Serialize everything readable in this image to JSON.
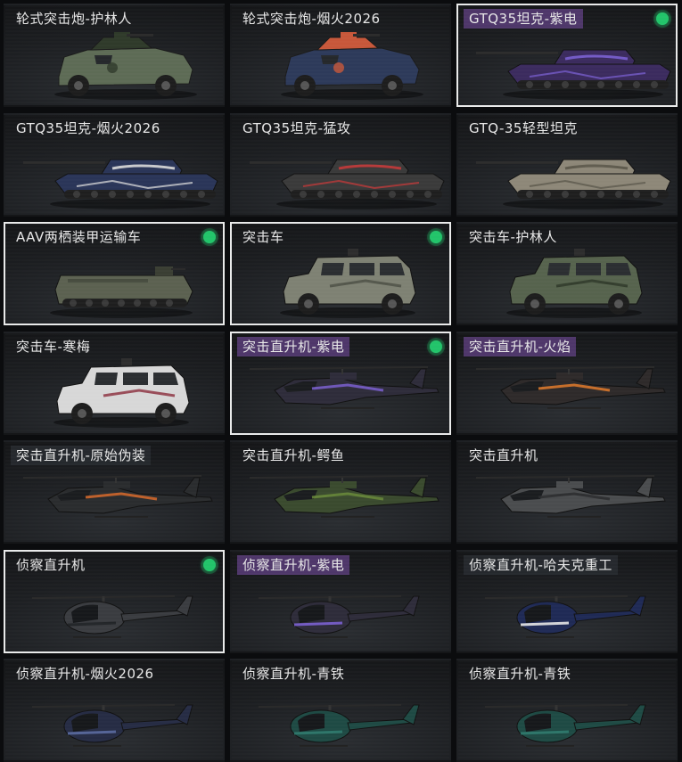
{
  "items": [
    {
      "label": "轮式突击炮-护林人",
      "type": "wheeled",
      "color": "#5d6b55",
      "accent": "#2f3a2a",
      "selected": false,
      "badge": false,
      "tint": ""
    },
    {
      "label": "轮式突击炮-烟火2026",
      "type": "wheeled",
      "color": "#2d3a5a",
      "accent": "#c7573a",
      "selected": false,
      "badge": false,
      "tint": ""
    },
    {
      "label": "GTQ35坦克-紫电",
      "type": "tank",
      "color": "#3b2b5e",
      "accent": "#7a5fd0",
      "selected": true,
      "badge": true,
      "tint": "purple"
    },
    {
      "label": "GTQ35坦克-烟火2026",
      "type": "tank",
      "color": "#2a3558",
      "accent": "#d9d9d9",
      "selected": false,
      "badge": false,
      "tint": ""
    },
    {
      "label": "GTQ35坦克-猛攻",
      "type": "tank",
      "color": "#3a3a3a",
      "accent": "#c43a3a",
      "selected": false,
      "badge": false,
      "tint": ""
    },
    {
      "label": "GTQ-35轻型坦克",
      "type": "tank",
      "color": "#8d8778",
      "accent": "#5a5649",
      "selected": false,
      "badge": false,
      "tint": ""
    },
    {
      "label": "AAV两栖装甲运输车",
      "type": "apc",
      "color": "#5b6150",
      "accent": "#3a3e33",
      "selected": true,
      "badge": true,
      "tint": ""
    },
    {
      "label": "突击车",
      "type": "suv",
      "color": "#7e8173",
      "accent": "#4a4c42",
      "selected": true,
      "badge": true,
      "tint": ""
    },
    {
      "label": "突击车-护林人",
      "type": "suv",
      "color": "#56634d",
      "accent": "#2c3527",
      "selected": false,
      "badge": false,
      "tint": ""
    },
    {
      "label": "突击车-寒梅",
      "type": "suv",
      "color": "#d7d7d7",
      "accent": "#8a2a3a",
      "selected": false,
      "badge": false,
      "tint": ""
    },
    {
      "label": "突击直升机-紫电",
      "type": "heli",
      "color": "#2e2c3a",
      "accent": "#7a5fd0",
      "selected": true,
      "badge": true,
      "tint": "purple"
    },
    {
      "label": "突击直升机-火焰",
      "type": "heli",
      "color": "#2e2a2a",
      "accent": "#e07a2a",
      "selected": false,
      "badge": false,
      "tint": "purple"
    },
    {
      "label": "突击直升机-原始伪装",
      "type": "heli",
      "color": "#2a2c2e",
      "accent": "#d86a2a",
      "selected": false,
      "badge": false,
      "tint": "dark"
    },
    {
      "label": "突击直升机-鳄鱼",
      "type": "heli",
      "color": "#3a4a2e",
      "accent": "#6a8a3a",
      "selected": false,
      "badge": false,
      "tint": ""
    },
    {
      "label": "突击直升机",
      "type": "heli",
      "color": "#4a4c4e",
      "accent": "#2a2c2e",
      "selected": false,
      "badge": false,
      "tint": ""
    },
    {
      "label": "侦察直升机",
      "type": "scout",
      "color": "#3a3c40",
      "accent": "#202226",
      "selected": true,
      "badge": true,
      "tint": ""
    },
    {
      "label": "侦察直升机-紫电",
      "type": "scout",
      "color": "#2e2c3a",
      "accent": "#7a5fd0",
      "selected": false,
      "badge": false,
      "tint": "purple"
    },
    {
      "label": "侦察直升机-哈夫克重工",
      "type": "scout",
      "color": "#1f2a55",
      "accent": "#e6e6e6",
      "selected": false,
      "badge": false,
      "tint": "dark"
    },
    {
      "label": "侦察直升机-烟火2026",
      "type": "scout",
      "color": "#262c44",
      "accent": "#5a6aa0",
      "selected": false,
      "badge": false,
      "tint": ""
    },
    {
      "label": "侦察直升机-青铁",
      "type": "scout",
      "color": "#1e4a44",
      "accent": "#2f7a6e",
      "selected": false,
      "badge": false,
      "tint": ""
    },
    {
      "label": "侦察直升机-青铁",
      "type": "scout",
      "color": "#1e4a44",
      "accent": "#2f7a6e",
      "selected": false,
      "badge": false,
      "tint": ""
    }
  ]
}
